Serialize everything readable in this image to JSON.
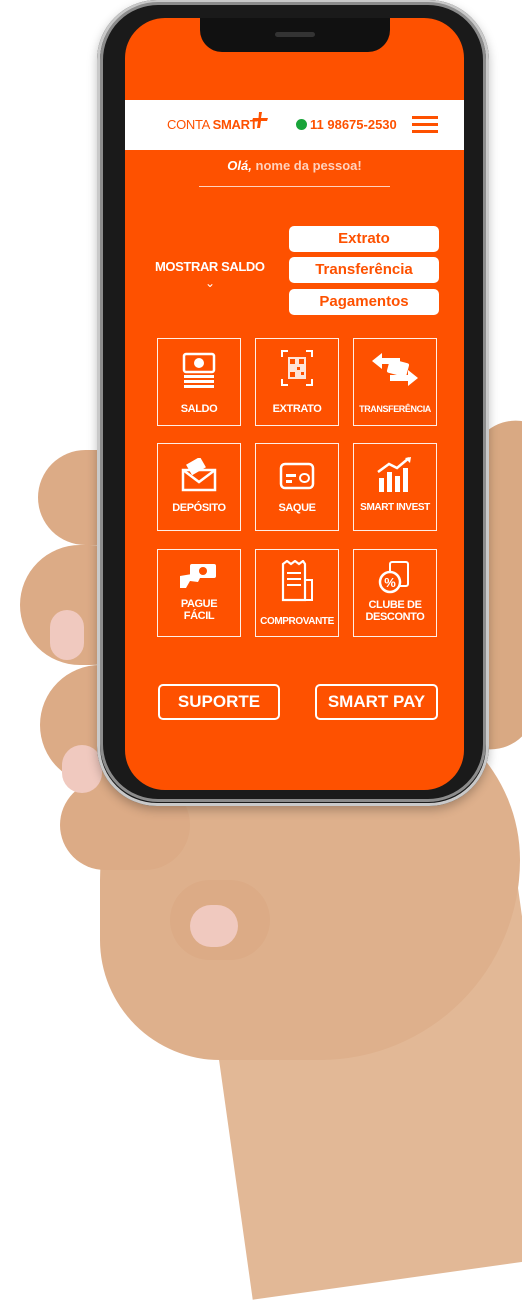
{
  "header": {
    "brand_prefix": "CONTA",
    "brand_name": "SMART",
    "phone": "11 98675-2530"
  },
  "greeting": {
    "hello": "Olá,",
    "name": "nome da pessoa!"
  },
  "balance": {
    "label": "MOSTRAR SALDO",
    "chevron": "⌄"
  },
  "quick_links": [
    "Extrato",
    "Transferência",
    "Pagamentos"
  ],
  "tiles": [
    {
      "label": "SALDO",
      "icon": "money-stack-icon"
    },
    {
      "label": "EXTRATO",
      "icon": "qr-code-icon"
    },
    {
      "label": "TRANSFERÊNCIA",
      "icon": "transfer-arrows-icon"
    },
    {
      "label": "DEPÓSITO",
      "icon": "envelope-deposit-icon"
    },
    {
      "label": "SAQUE",
      "icon": "card-icon"
    },
    {
      "label": "SMART INVEST",
      "icon": "growth-chart-icon"
    },
    {
      "label": "PAGUE\nFÁCIL",
      "label_line1": "PAGUE",
      "label_line2": "FÁCIL",
      "icon": "hand-money-icon"
    },
    {
      "label": "COMPROVANTE",
      "icon": "receipt-icon"
    },
    {
      "label": "CLUBE DE\nDESCONTO",
      "label_line1": "CLUBE DE",
      "label_line2": "DESCONTO",
      "icon": "discount-icon"
    }
  ],
  "buttons": {
    "support": "SUPORTE",
    "smart_pay": "SMART PAY"
  },
  "colors": {
    "brand_orange": "#fe5100",
    "white": "#ffffff",
    "whatsapp_green": "#19a43a"
  }
}
